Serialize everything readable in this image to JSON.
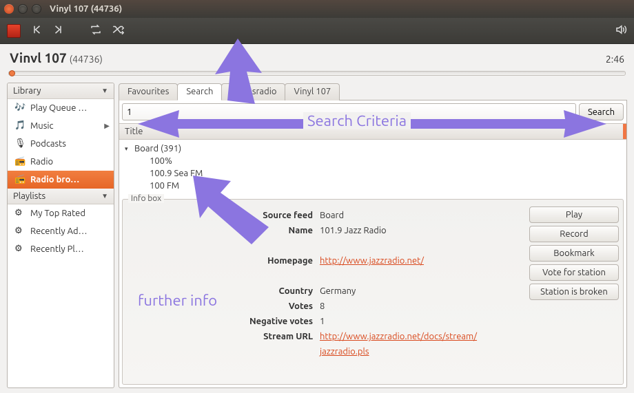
{
  "window": {
    "title": "Vinyl 107 (44736)"
  },
  "player": {
    "track": "Vinvl 107",
    "extra": "(44736)",
    "time": "2:46"
  },
  "sidebar": {
    "library_label": "Library",
    "playlists_label": "Playlists",
    "items": [
      {
        "label": "Play Queue …",
        "icon": "🎵"
      },
      {
        "label": "Music",
        "icon": "🎵"
      },
      {
        "label": "Podcasts",
        "icon": "🎙"
      },
      {
        "label": "Radio",
        "icon": "📻"
      },
      {
        "label": "Radio bro…",
        "icon": "📻"
      }
    ],
    "playlists": [
      {
        "label": "My Top Rated"
      },
      {
        "label": "Recently Ad…"
      },
      {
        "label": "Recently Pl…"
      }
    ]
  },
  "tabs": [
    {
      "label": "Favourites"
    },
    {
      "label": "Search"
    },
    {
      "label": "Oldiesradio"
    },
    {
      "label": "Vinyl 107"
    }
  ],
  "search": {
    "value": "1",
    "button": "Search",
    "column": "Title"
  },
  "results": {
    "group": "Board (391)",
    "rows": [
      "100%",
      "100.9 Sea FM",
      "100 FM"
    ]
  },
  "info": {
    "legend": "Info box",
    "labels": {
      "source": "Source feed",
      "name": "Name",
      "homepage": "Homepage",
      "country": "Country",
      "votes": "Votes",
      "negvotes": "Negative votes",
      "stream": "Stream URL"
    },
    "values": {
      "source": "Board",
      "name": "101.9 Jazz Radio",
      "homepage": "http://www.jazzradio.net/",
      "country": "Germany",
      "votes": "8",
      "negvotes": "1",
      "stream1": "http://www.jazzradio.net/docs/stream/",
      "stream2": "jazzradio.pls"
    },
    "buttons": {
      "play": "Play",
      "record": "Record",
      "bookmark": "Bookmark",
      "vote": "Vote for station",
      "broken": "Station is broken"
    }
  },
  "annotations": {
    "criteria": "Search Criteria",
    "further": "further info"
  }
}
